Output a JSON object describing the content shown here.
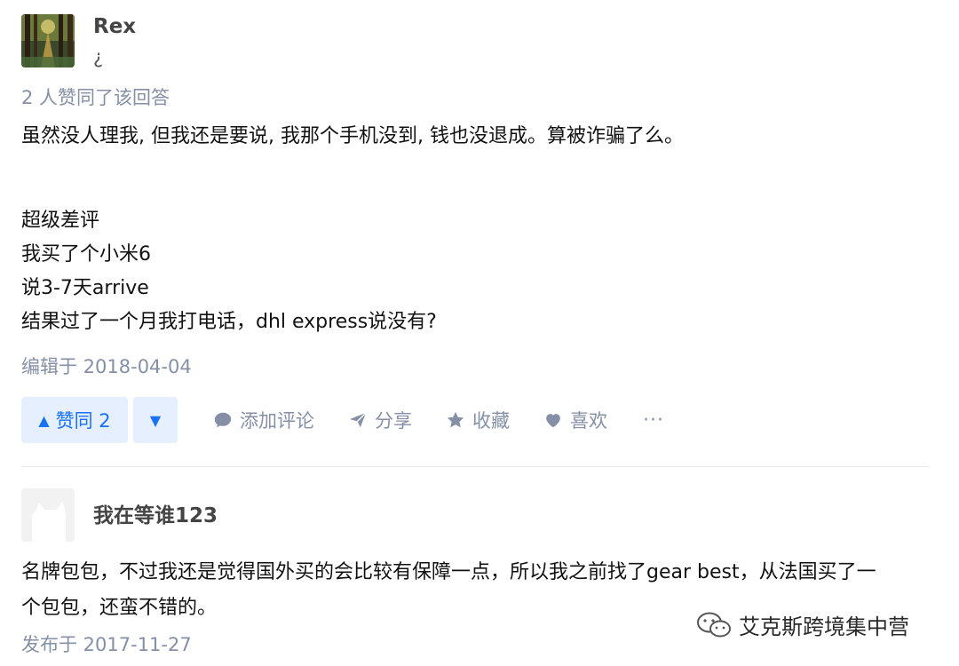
{
  "answer1": {
    "author_name": "Rex",
    "author_bio": "¿",
    "vote_summary": "2 人赞同了该回答",
    "content_lines": [
      "虽然没人理我, 但我还是要说, 我那个手机没到, 钱也没退成。算被诈骗了么。",
      "超级差评",
      "我买了个小米6",
      "说3-7天arrive",
      "结果过了一个月我打电话，dhl express说没有?"
    ],
    "edited_time": "编辑于 2018-04-04",
    "actions": {
      "upvote_label": "赞同 2",
      "comment_label": "添加评论",
      "share_label": "分享",
      "favorite_label": "收藏",
      "like_label": "喜欢",
      "more_label": "···"
    }
  },
  "answer2": {
    "author_name": "我在等谁123",
    "content_lines": [
      "名牌包包，不过我还是觉得国外买的会比较有保障一点，所以我之前找了gear best，从法国买了一",
      "个包包，还蛮不错的。"
    ],
    "published_time": "发布于 2017-11-27"
  },
  "watermark": {
    "text": "艾克斯跨境集中营",
    "icon": "wechat-icon"
  },
  "colors": {
    "accent": "#1772f6",
    "accent_bg": "#e5effd",
    "meta_gray": "#8590a6"
  }
}
